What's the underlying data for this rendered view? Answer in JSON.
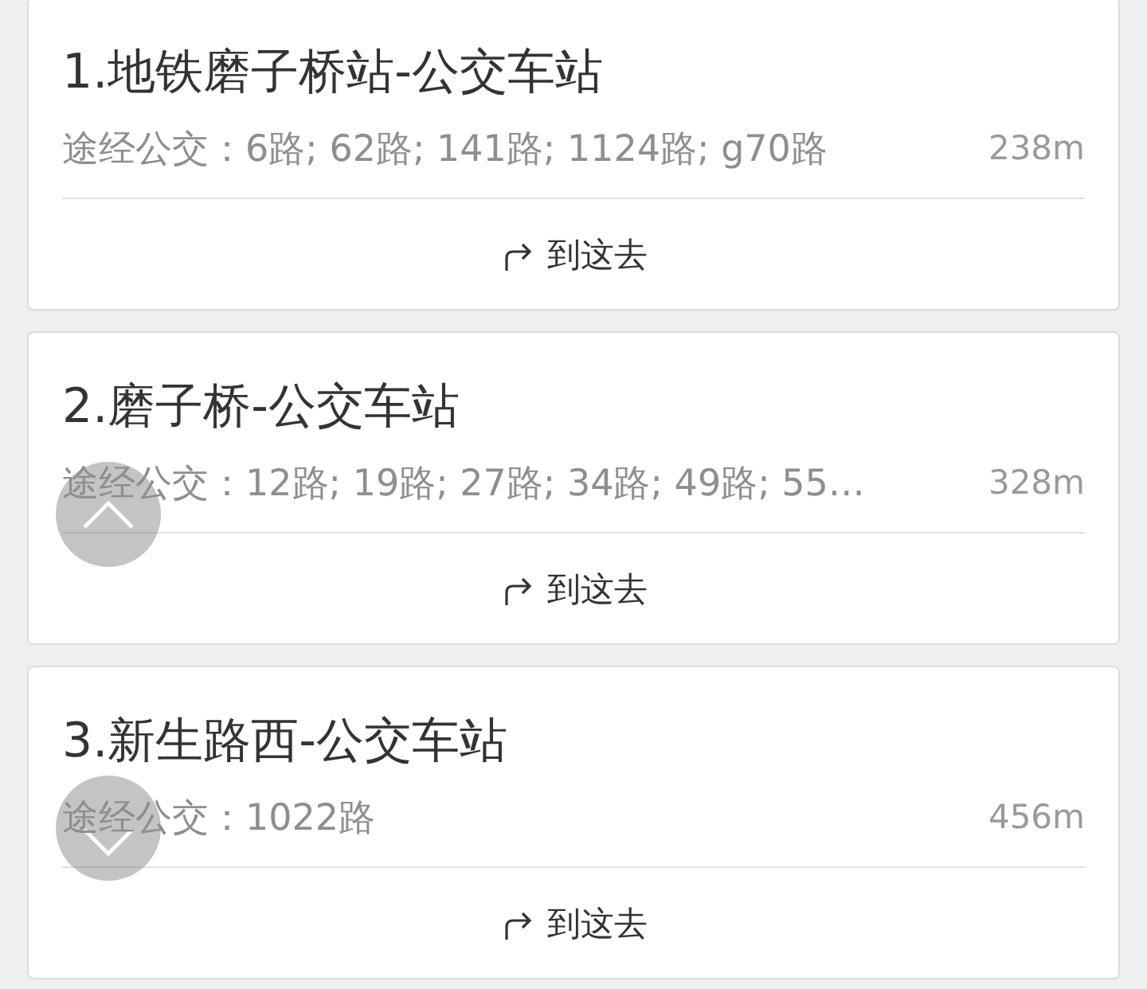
{
  "stations": [
    {
      "name": "1.地铁磨子桥站-公交车站",
      "routes": "途经公交：6路; 62路; 141路; 1124路; g70路",
      "distance": "238m",
      "action": "到这去"
    },
    {
      "name": "2.磨子桥-公交车站",
      "routes": "途经公交：12路; 19路; 27路; 34路; 49路; 55…",
      "distance": "328m",
      "action": "到这去"
    },
    {
      "name": "3.新生路西-公交车站",
      "routes": "途经公交：1022路",
      "distance": "456m",
      "action": "到这去"
    }
  ]
}
